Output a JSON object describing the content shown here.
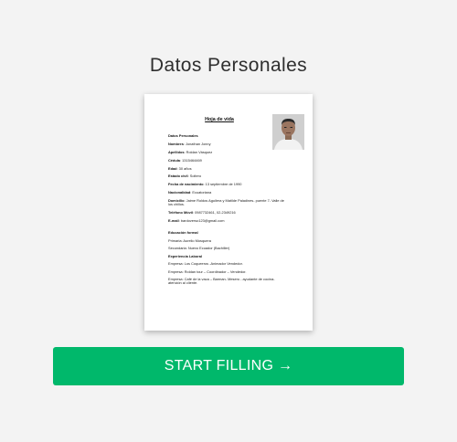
{
  "title": "Datos Personales",
  "doc": {
    "heading": "Hoja de vida",
    "section_personal": "Datos Personales",
    "fields": [
      {
        "label": "Nombres",
        "value": ": Jonathan Jonny"
      },
      {
        "label": "Apellidos",
        "value": ": Roldan Vásquez"
      },
      {
        "label": "Cédula",
        "value": ": 1315464469"
      },
      {
        "label": "Edad",
        "value": ": 30 años"
      },
      {
        "label": "Estado civil",
        "value": ": Soltero"
      },
      {
        "label": "Fecha de nacimiento",
        "value": ": 13 septiembre de 1990"
      },
      {
        "label": "Nacionalidad",
        "value": ": Ecuatoriana"
      },
      {
        "label": "Domicilio",
        "value": ": Jaime Roldos Aguilera y Matilde Paladines- puente 7- Valle de los chillos."
      },
      {
        "label": "Teléfono Móvil",
        "value": ": 0987732461,  02-2349216"
      },
      {
        "label": " E-mail",
        "value": ": bardoverso123@gmail.com"
      }
    ],
    "education_title": "Educación formal",
    "primaria": "Primaria: Aurelio Mosquera",
    "secundaria": "Secundaria: Nuevo Ecuador (Bachiller)",
    "experience_title": "Experiencia Laboral",
    "jobs": [
      "Empresa: Los Coqueeros -Animador Vendedor.",
      "Empresa: Roldan tour – Coordinador – Vendedor.",
      "Empresa: Café de la vaca – Barman- Mesero - ayudante de cocina- atención al cliente."
    ]
  },
  "cta_label": "START FILLING →",
  "colors": {
    "cta": "#00b86b",
    "background": "#f3f3f3"
  }
}
